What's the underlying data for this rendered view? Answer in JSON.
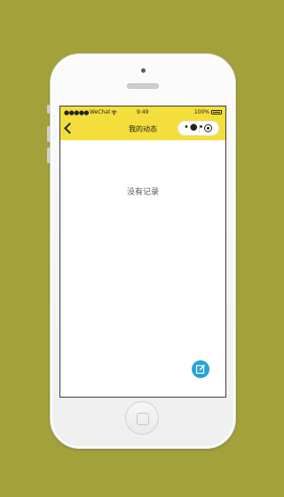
{
  "status_bar": {
    "signal_dots": "●●●●●",
    "carrier": "WeChat",
    "time": "9:49",
    "battery_percent": "100%"
  },
  "nav": {
    "title": "我的动态",
    "back_icon": "chevron-left-icon",
    "more_icon": "more-dots-icon",
    "close_icon": "target-circle-icon"
  },
  "main": {
    "empty_text": "没有记录"
  },
  "fab": {
    "icon": "edit-icon",
    "color": "#27a3d8"
  },
  "colors": {
    "background": "#a3a23a",
    "header": "#f4de3c"
  }
}
